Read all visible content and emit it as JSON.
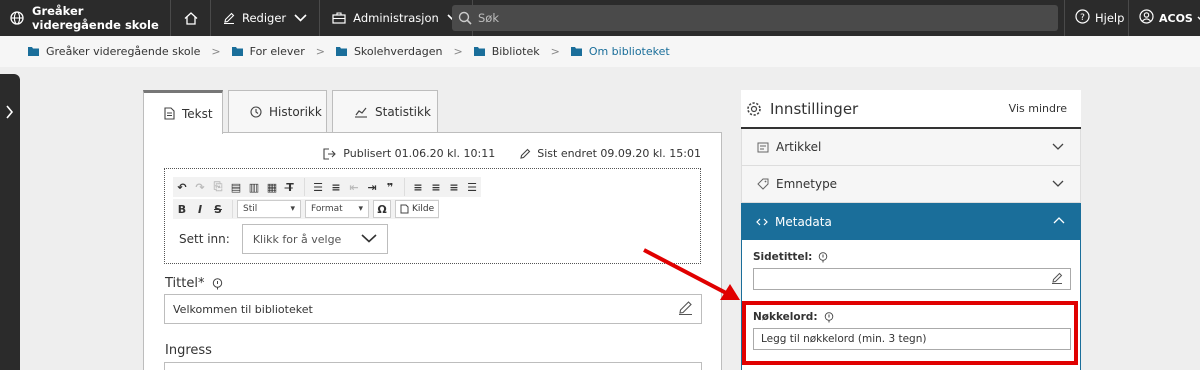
{
  "topbar": {
    "site_name": "Greåker videregående skole",
    "edit_label": "Rediger",
    "admin_label": "Administrasjon",
    "search_placeholder": "Søk",
    "help_label": "Hjelp",
    "user_label": "ACOS"
  },
  "breadcrumb": [
    "Greåker videregående skole",
    "For elever",
    "Skolehverdagen",
    "Bibliotek",
    "Om biblioteket"
  ],
  "tabs": [
    "Tekst",
    "Historikk",
    "Statistikk"
  ],
  "editor": {
    "published": "Publisert 01.06.20 kl. 10:11",
    "last_changed": "Sist endret 09.09.20 kl. 15:01",
    "style_combo": "Stil",
    "format_combo": "Format",
    "source_button": "Kilde",
    "insert_label": "Sett inn:",
    "insert_select": "Klikk for å velge",
    "title_label": "Tittel*",
    "title_value": "Velkommen til biblioteket",
    "ingress_label": "Ingress"
  },
  "settings": {
    "title": "Innstillinger",
    "show_less": "Vis mindre",
    "sections": [
      "Artikkel",
      "Emnetype",
      "Metadata"
    ],
    "page_title_label": "Sidetittel:",
    "page_title_value": "",
    "keywords_label": "Nøkkelord:",
    "keywords_placeholder": "Legg til nøkkelord (min. 3 tegn)"
  },
  "colors": {
    "topbar": "#2b2b2b",
    "accent": "#1a6e9a",
    "highlight": "#e00000"
  }
}
